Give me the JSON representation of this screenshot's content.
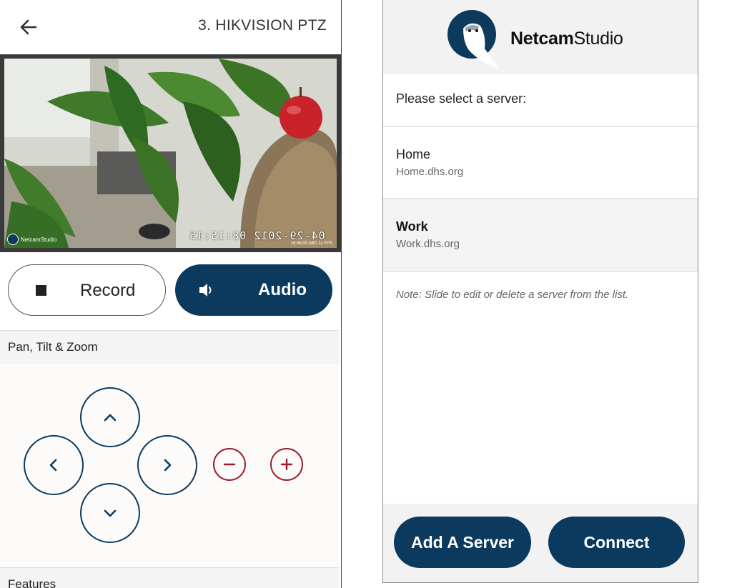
{
  "left": {
    "title": "3. HIKVISION PTZ",
    "video": {
      "timestamp": "04-29-2012 08:15:15",
      "brand": "NetcamStudio",
      "info": "16:45:00 ABD  11 FPS"
    },
    "record_label": "Record",
    "audio_label": "Audio",
    "ptz_header": "Pan, Tilt & Zoom",
    "features_header": "Features",
    "icons": {
      "back": "arrow-left-icon",
      "record": "stop-square-icon",
      "audio": "speaker-icon",
      "up": "chevron-up-icon",
      "down": "chevron-down-icon",
      "left": "chevron-left-icon",
      "right": "chevron-right-icon",
      "zoom_out": "minus-circle-icon",
      "zoom_in": "plus-circle-icon"
    },
    "colors": {
      "primary": "#0b3a5e",
      "zoom": "#9b1c2a"
    }
  },
  "right": {
    "brand_bold": "Netcam",
    "brand_light": "Studio",
    "prompt": "Please select a server:",
    "servers": [
      {
        "name": "Home",
        "host": "Home.dhs.org"
      },
      {
        "name": "Work",
        "host": "Work.dhs.org"
      }
    ],
    "note": "Note: Slide to edit or delete a server from the list.",
    "add_label": "Add A Server",
    "connect_label": "Connect"
  }
}
